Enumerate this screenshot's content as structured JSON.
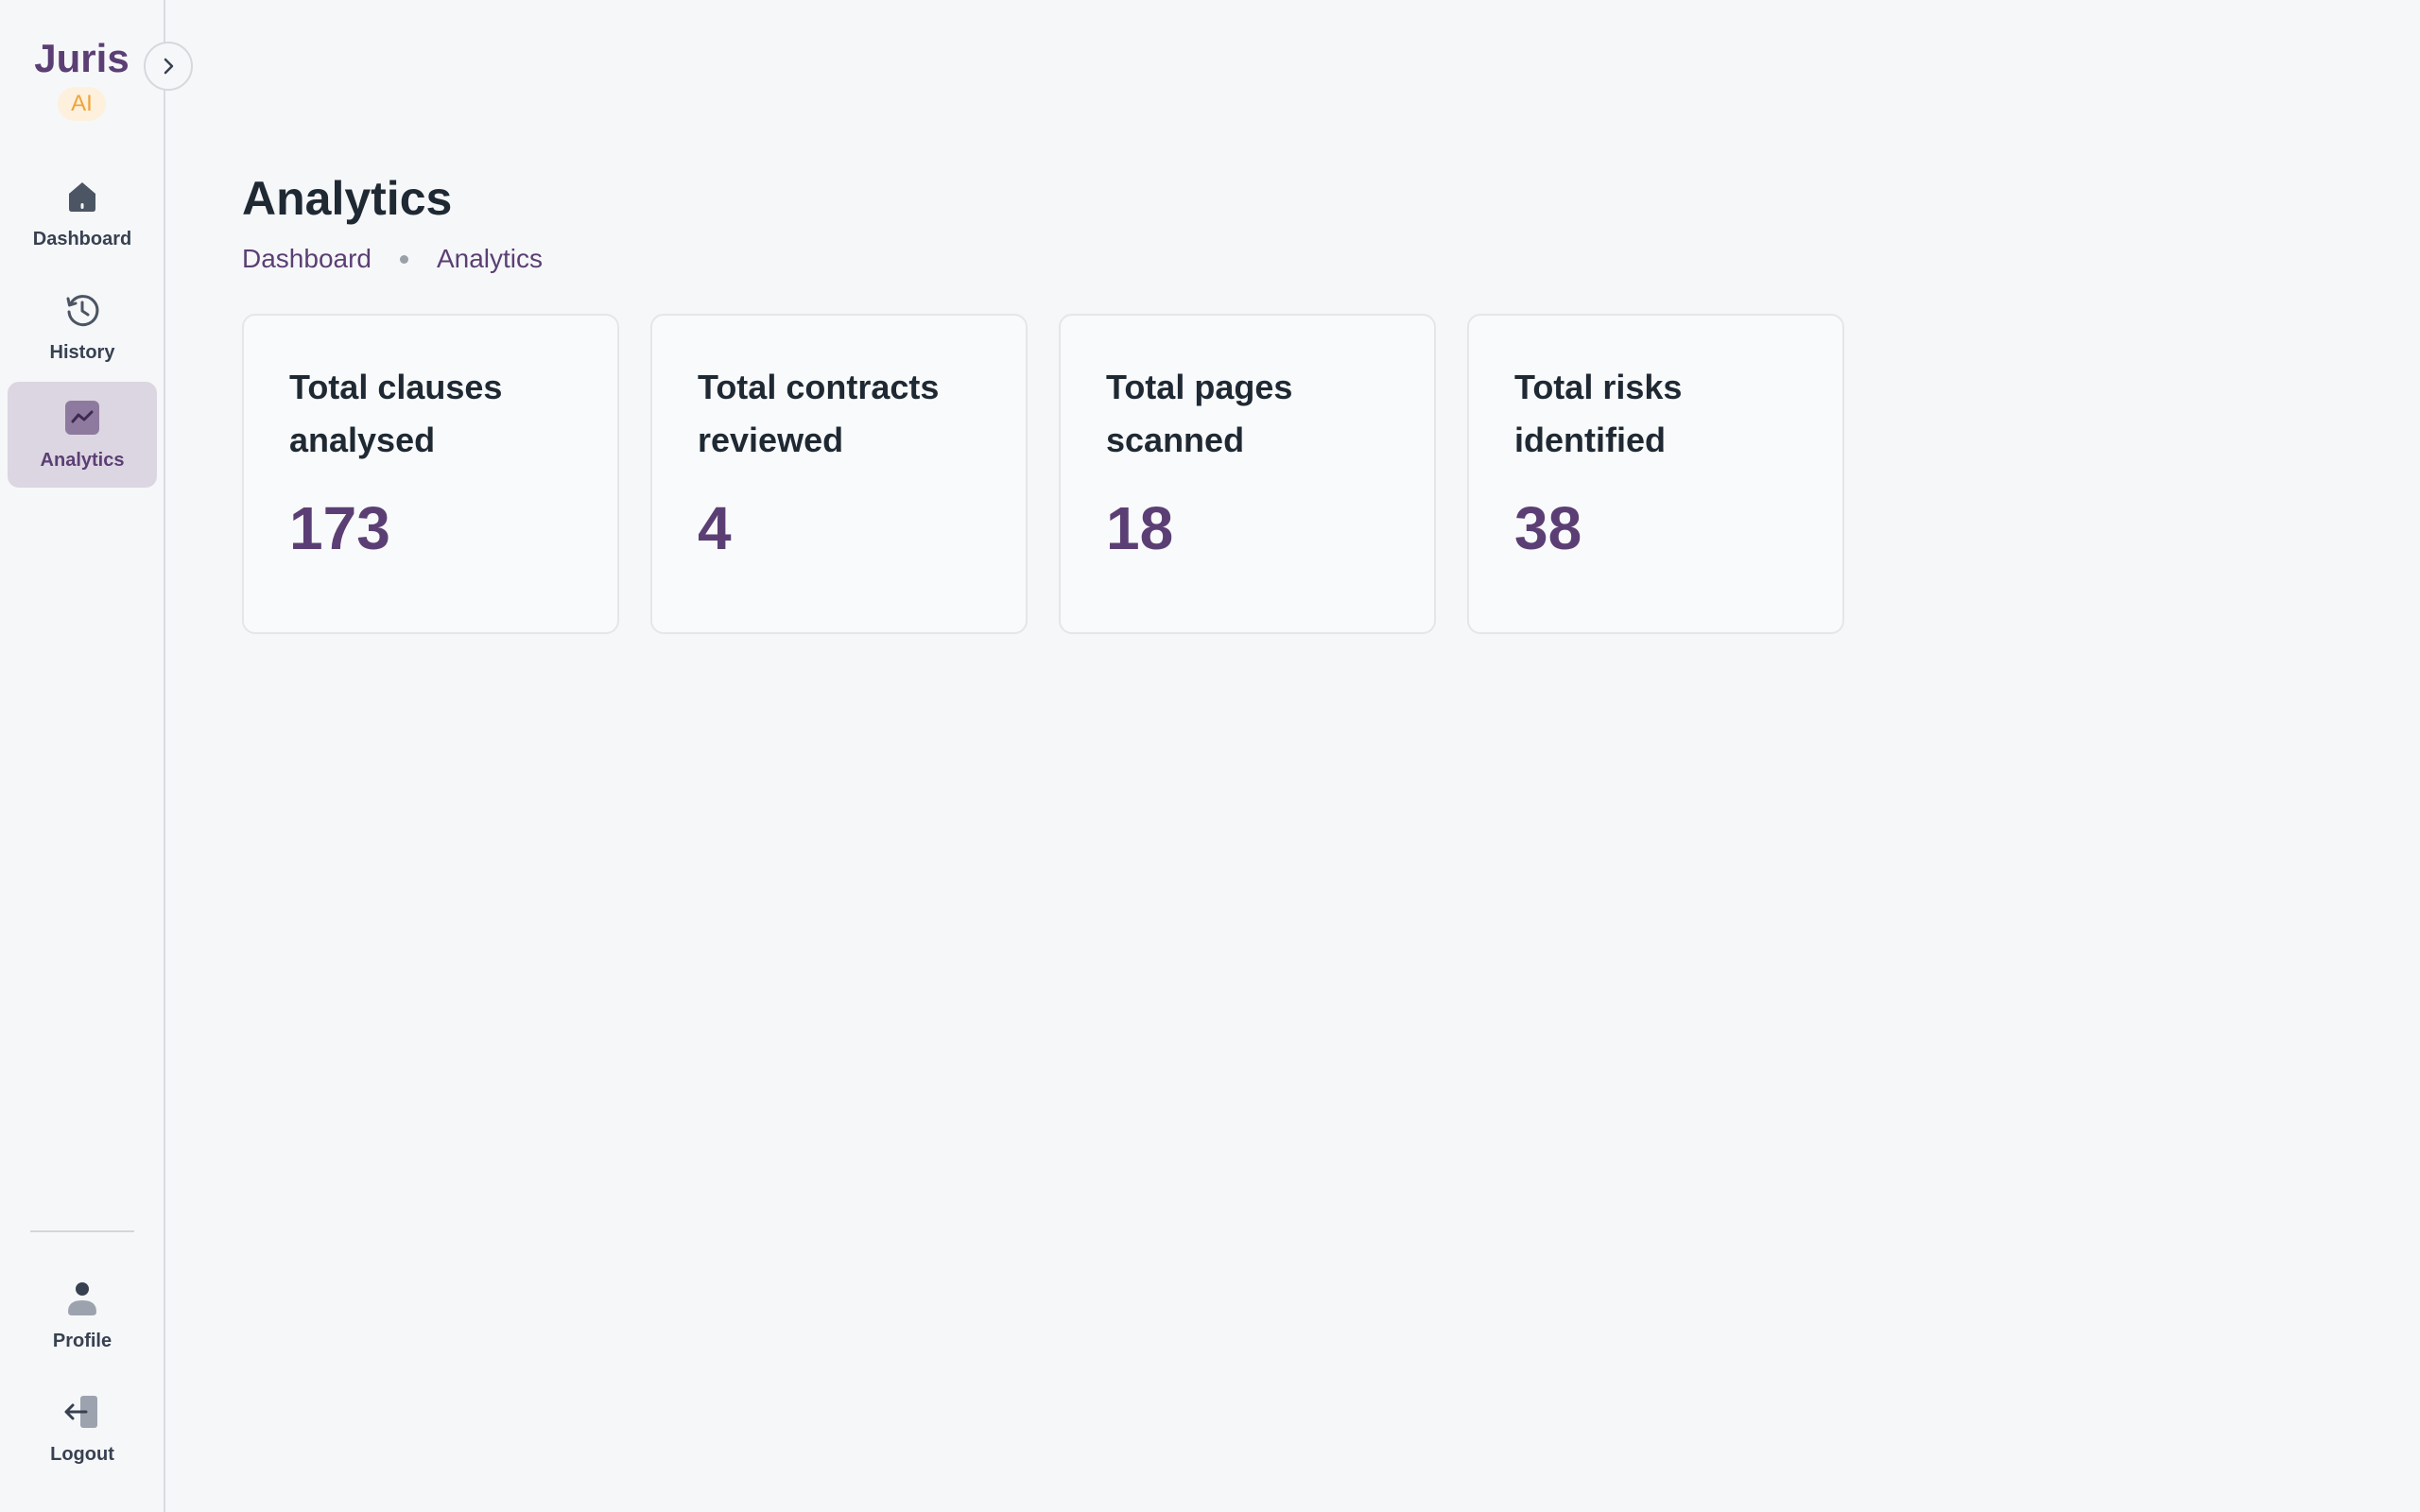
{
  "brand": {
    "name": "Juris",
    "badge": "AI"
  },
  "sidebar": {
    "nav": [
      {
        "label": "Dashboard",
        "icon": "home-icon"
      },
      {
        "label": "History",
        "icon": "history-icon"
      },
      {
        "label": "Analytics",
        "icon": "analytics-icon",
        "active": true
      }
    ],
    "bottom": [
      {
        "label": "Profile",
        "icon": "user-icon"
      },
      {
        "label": "Logout",
        "icon": "logout-icon"
      }
    ]
  },
  "page": {
    "title": "Analytics",
    "breadcrumb": [
      "Dashboard",
      "Analytics"
    ]
  },
  "stats": [
    {
      "title": "Total clauses analysed",
      "value": "173"
    },
    {
      "title": "Total contracts reviewed",
      "value": "4"
    },
    {
      "title": "Total pages scanned",
      "value": "18"
    },
    {
      "title": "Total risks identified",
      "value": "38"
    }
  ],
  "colors": {
    "accent": "#5b3f74",
    "badge_text": "#f0a43a",
    "badge_bg": "#fdf0dd",
    "active_nav_bg": "#dcd6e2",
    "background": "#f6f7f9"
  }
}
